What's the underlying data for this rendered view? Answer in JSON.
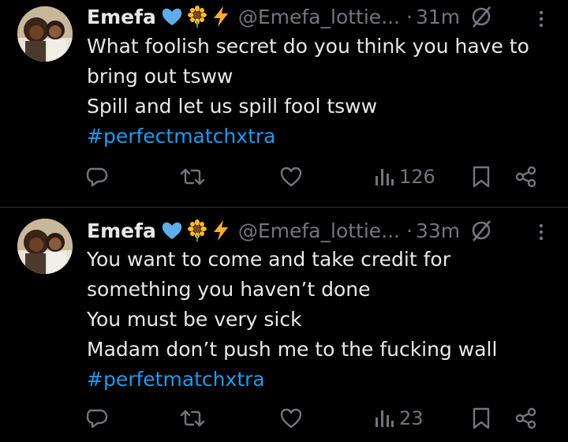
{
  "tweets": [
    {
      "name": "Emefa",
      "badges": [
        "blue-heart-icon",
        "sunflower-icon",
        "lightning-icon"
      ],
      "handle": "@Emefa_lottie...",
      "separator": "·",
      "time": "31m",
      "lines": [
        "What foolish secret do you think you have to",
        "bring out tsww",
        "Spill and let us spill fool tsww"
      ],
      "hashtag": "#perfectmatchxtra",
      "views": "126"
    },
    {
      "name": "Emefa",
      "badges": [
        "blue-heart-icon",
        "sunflower-icon",
        "lightning-icon"
      ],
      "handle": "@Emefa_lottie...",
      "separator": "·",
      "time": "33m",
      "lines": [
        "You want to come and take credit for",
        "something you haven’t done",
        "You must be very sick",
        "Madam don’t push me to the fucking wall"
      ],
      "hashtag": "#perfetmatchxtra",
      "views": "23"
    }
  ],
  "colors": {
    "background": "#000000",
    "text": "#e7e9ea",
    "muted": "#71767b",
    "link": "#1d9bf0",
    "divider": "#2f3336"
  }
}
